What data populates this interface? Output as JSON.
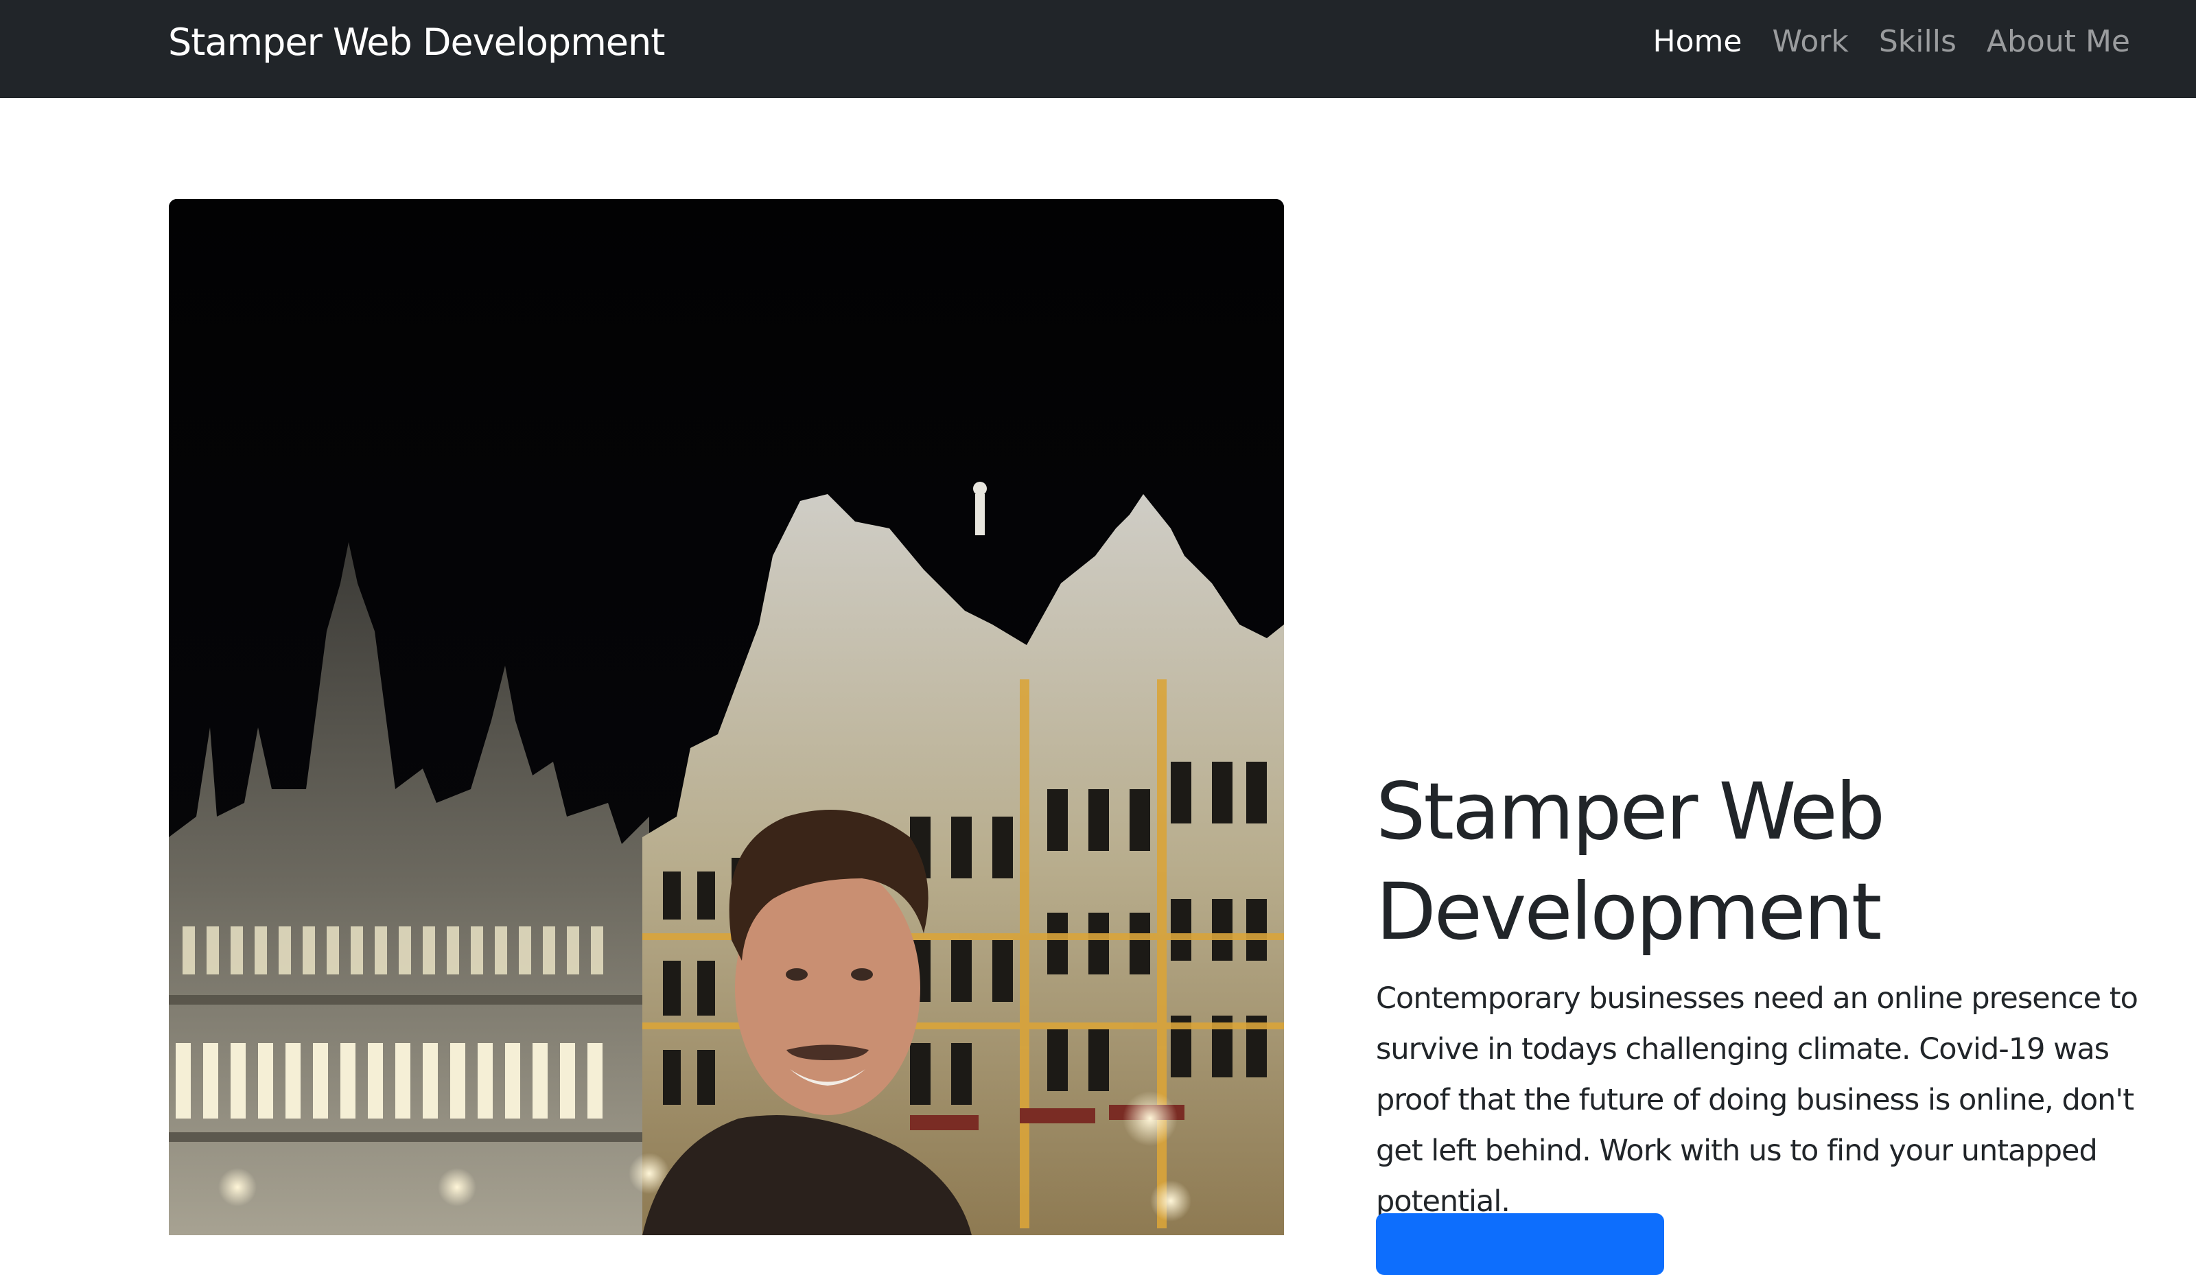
{
  "navbar": {
    "brand": "Stamper Web Development",
    "links": [
      {
        "label": "Home",
        "active": true
      },
      {
        "label": "Work",
        "active": false
      },
      {
        "label": "Skills",
        "active": false
      },
      {
        "label": "About Me",
        "active": false
      }
    ]
  },
  "hero": {
    "title": "Stamper Web Development",
    "lead": "Contemporary businesses need an online presence to survive in todays challenging climate. Covid-19 was proof that the future of doing business is online, don't get left behind. Work with us to find your untapped potential.",
    "cta_label": ""
  },
  "colors": {
    "navbar_bg": "#212529",
    "accent": "#0d6efd",
    "text": "#212529"
  }
}
